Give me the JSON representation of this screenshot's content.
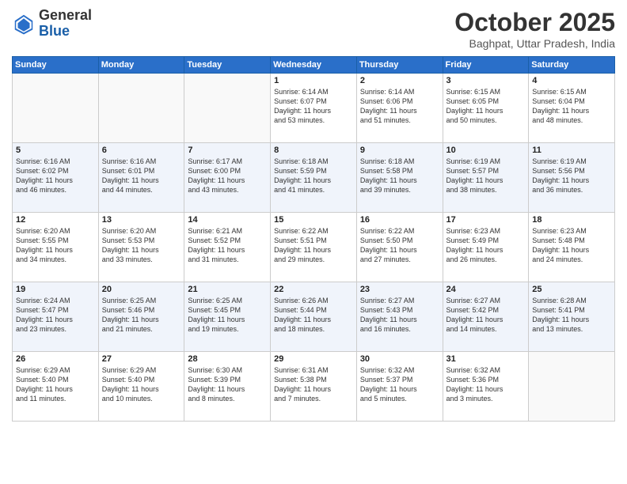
{
  "header": {
    "logo_general": "General",
    "logo_blue": "Blue",
    "month": "October 2025",
    "location": "Baghpat, Uttar Pradesh, India"
  },
  "days_of_week": [
    "Sunday",
    "Monday",
    "Tuesday",
    "Wednesday",
    "Thursday",
    "Friday",
    "Saturday"
  ],
  "weeks": [
    [
      {
        "day": "",
        "info": ""
      },
      {
        "day": "",
        "info": ""
      },
      {
        "day": "",
        "info": ""
      },
      {
        "day": "1",
        "info": "Sunrise: 6:14 AM\nSunset: 6:07 PM\nDaylight: 11 hours\nand 53 minutes."
      },
      {
        "day": "2",
        "info": "Sunrise: 6:14 AM\nSunset: 6:06 PM\nDaylight: 11 hours\nand 51 minutes."
      },
      {
        "day": "3",
        "info": "Sunrise: 6:15 AM\nSunset: 6:05 PM\nDaylight: 11 hours\nand 50 minutes."
      },
      {
        "day": "4",
        "info": "Sunrise: 6:15 AM\nSunset: 6:04 PM\nDaylight: 11 hours\nand 48 minutes."
      }
    ],
    [
      {
        "day": "5",
        "info": "Sunrise: 6:16 AM\nSunset: 6:02 PM\nDaylight: 11 hours\nand 46 minutes."
      },
      {
        "day": "6",
        "info": "Sunrise: 6:16 AM\nSunset: 6:01 PM\nDaylight: 11 hours\nand 44 minutes."
      },
      {
        "day": "7",
        "info": "Sunrise: 6:17 AM\nSunset: 6:00 PM\nDaylight: 11 hours\nand 43 minutes."
      },
      {
        "day": "8",
        "info": "Sunrise: 6:18 AM\nSunset: 5:59 PM\nDaylight: 11 hours\nand 41 minutes."
      },
      {
        "day": "9",
        "info": "Sunrise: 6:18 AM\nSunset: 5:58 PM\nDaylight: 11 hours\nand 39 minutes."
      },
      {
        "day": "10",
        "info": "Sunrise: 6:19 AM\nSunset: 5:57 PM\nDaylight: 11 hours\nand 38 minutes."
      },
      {
        "day": "11",
        "info": "Sunrise: 6:19 AM\nSunset: 5:56 PM\nDaylight: 11 hours\nand 36 minutes."
      }
    ],
    [
      {
        "day": "12",
        "info": "Sunrise: 6:20 AM\nSunset: 5:55 PM\nDaylight: 11 hours\nand 34 minutes."
      },
      {
        "day": "13",
        "info": "Sunrise: 6:20 AM\nSunset: 5:53 PM\nDaylight: 11 hours\nand 33 minutes."
      },
      {
        "day": "14",
        "info": "Sunrise: 6:21 AM\nSunset: 5:52 PM\nDaylight: 11 hours\nand 31 minutes."
      },
      {
        "day": "15",
        "info": "Sunrise: 6:22 AM\nSunset: 5:51 PM\nDaylight: 11 hours\nand 29 minutes."
      },
      {
        "day": "16",
        "info": "Sunrise: 6:22 AM\nSunset: 5:50 PM\nDaylight: 11 hours\nand 27 minutes."
      },
      {
        "day": "17",
        "info": "Sunrise: 6:23 AM\nSunset: 5:49 PM\nDaylight: 11 hours\nand 26 minutes."
      },
      {
        "day": "18",
        "info": "Sunrise: 6:23 AM\nSunset: 5:48 PM\nDaylight: 11 hours\nand 24 minutes."
      }
    ],
    [
      {
        "day": "19",
        "info": "Sunrise: 6:24 AM\nSunset: 5:47 PM\nDaylight: 11 hours\nand 23 minutes."
      },
      {
        "day": "20",
        "info": "Sunrise: 6:25 AM\nSunset: 5:46 PM\nDaylight: 11 hours\nand 21 minutes."
      },
      {
        "day": "21",
        "info": "Sunrise: 6:25 AM\nSunset: 5:45 PM\nDaylight: 11 hours\nand 19 minutes."
      },
      {
        "day": "22",
        "info": "Sunrise: 6:26 AM\nSunset: 5:44 PM\nDaylight: 11 hours\nand 18 minutes."
      },
      {
        "day": "23",
        "info": "Sunrise: 6:27 AM\nSunset: 5:43 PM\nDaylight: 11 hours\nand 16 minutes."
      },
      {
        "day": "24",
        "info": "Sunrise: 6:27 AM\nSunset: 5:42 PM\nDaylight: 11 hours\nand 14 minutes."
      },
      {
        "day": "25",
        "info": "Sunrise: 6:28 AM\nSunset: 5:41 PM\nDaylight: 11 hours\nand 13 minutes."
      }
    ],
    [
      {
        "day": "26",
        "info": "Sunrise: 6:29 AM\nSunset: 5:40 PM\nDaylight: 11 hours\nand 11 minutes."
      },
      {
        "day": "27",
        "info": "Sunrise: 6:29 AM\nSunset: 5:40 PM\nDaylight: 11 hours\nand 10 minutes."
      },
      {
        "day": "28",
        "info": "Sunrise: 6:30 AM\nSunset: 5:39 PM\nDaylight: 11 hours\nand 8 minutes."
      },
      {
        "day": "29",
        "info": "Sunrise: 6:31 AM\nSunset: 5:38 PM\nDaylight: 11 hours\nand 7 minutes."
      },
      {
        "day": "30",
        "info": "Sunrise: 6:32 AM\nSunset: 5:37 PM\nDaylight: 11 hours\nand 5 minutes."
      },
      {
        "day": "31",
        "info": "Sunrise: 6:32 AM\nSunset: 5:36 PM\nDaylight: 11 hours\nand 3 minutes."
      },
      {
        "day": "",
        "info": ""
      }
    ]
  ]
}
